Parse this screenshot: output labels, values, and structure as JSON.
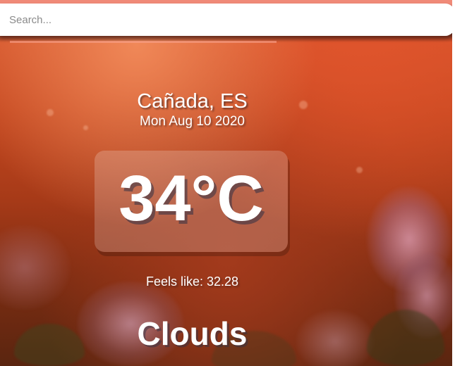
{
  "search": {
    "placeholder": "Search...",
    "value": ""
  },
  "location": {
    "city": "Cañada",
    "country": "ES",
    "display": "Cañada, ES"
  },
  "date": "Mon Aug 10 2020",
  "temperature": {
    "display": "34°C"
  },
  "feels_like": {
    "label": "Feels like:",
    "value": "32.28"
  },
  "weather": "Clouds",
  "colors": {
    "background_top": "#dd5a30",
    "background_bottom": "#5a2510",
    "search_bg": "#ffffff",
    "text": "#ffffff"
  }
}
